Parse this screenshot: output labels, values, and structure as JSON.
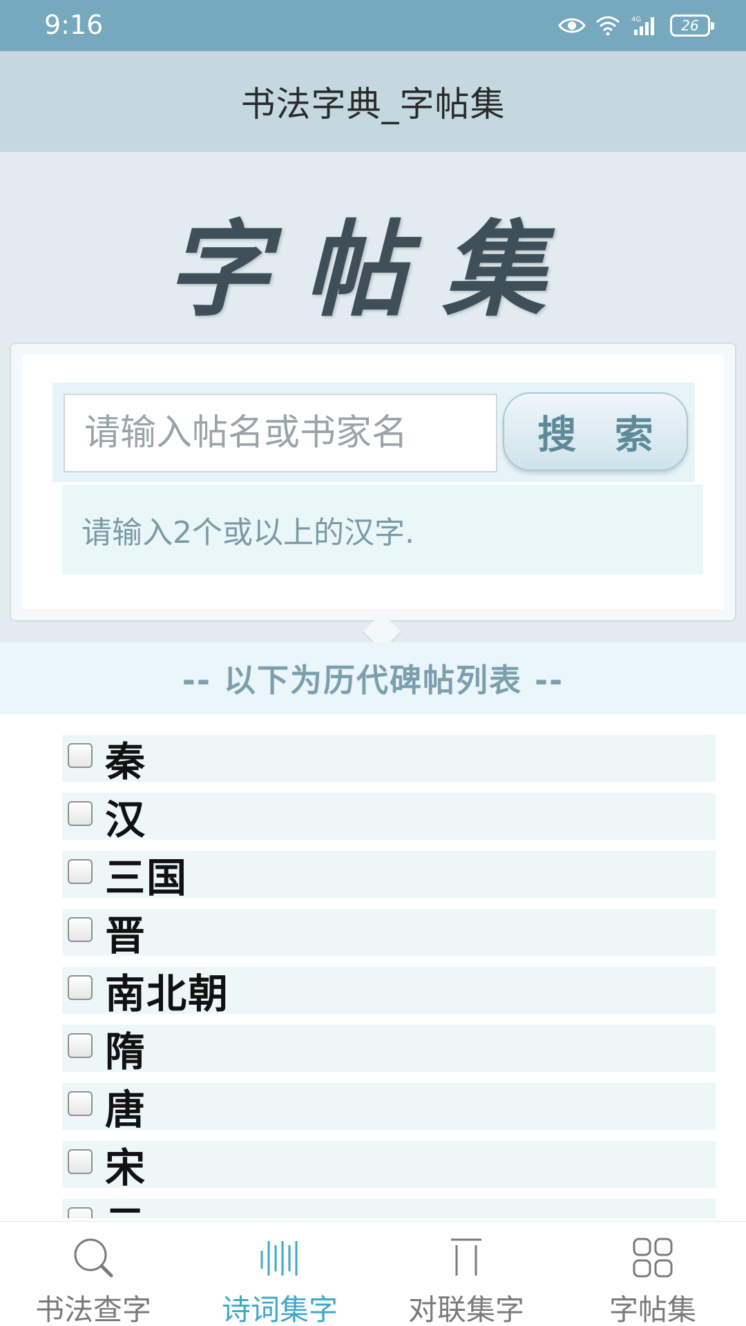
{
  "status_bar": {
    "time": "9:16",
    "battery": "26",
    "network": "4G"
  },
  "header": {
    "title": "书法字典_字帖集"
  },
  "banner": {
    "logo_text": "字帖集"
  },
  "search": {
    "placeholder": "请输入帖名或书家名",
    "button_label": "搜 索",
    "hint": "请输入2个或以上的汉字."
  },
  "list": {
    "heading": "-- 以下为历代碑帖列表 --",
    "items": [
      {
        "label": "秦"
      },
      {
        "label": "汉"
      },
      {
        "label": "三国"
      },
      {
        "label": "晋"
      },
      {
        "label": "南北朝"
      },
      {
        "label": "隋"
      },
      {
        "label": "唐"
      },
      {
        "label": "宋"
      },
      {
        "label": "元"
      }
    ]
  },
  "bottom_nav": {
    "items": [
      {
        "label": "书法查字",
        "icon": "search-icon"
      },
      {
        "label": "诗词集字",
        "icon": "poem-icon",
        "active": true
      },
      {
        "label": "对联集字",
        "icon": "couplet-icon"
      },
      {
        "label": "字帖集",
        "icon": "grid-icon"
      }
    ],
    "active_color": "#3fa7c9",
    "inactive_color": "#7a7a7a"
  }
}
